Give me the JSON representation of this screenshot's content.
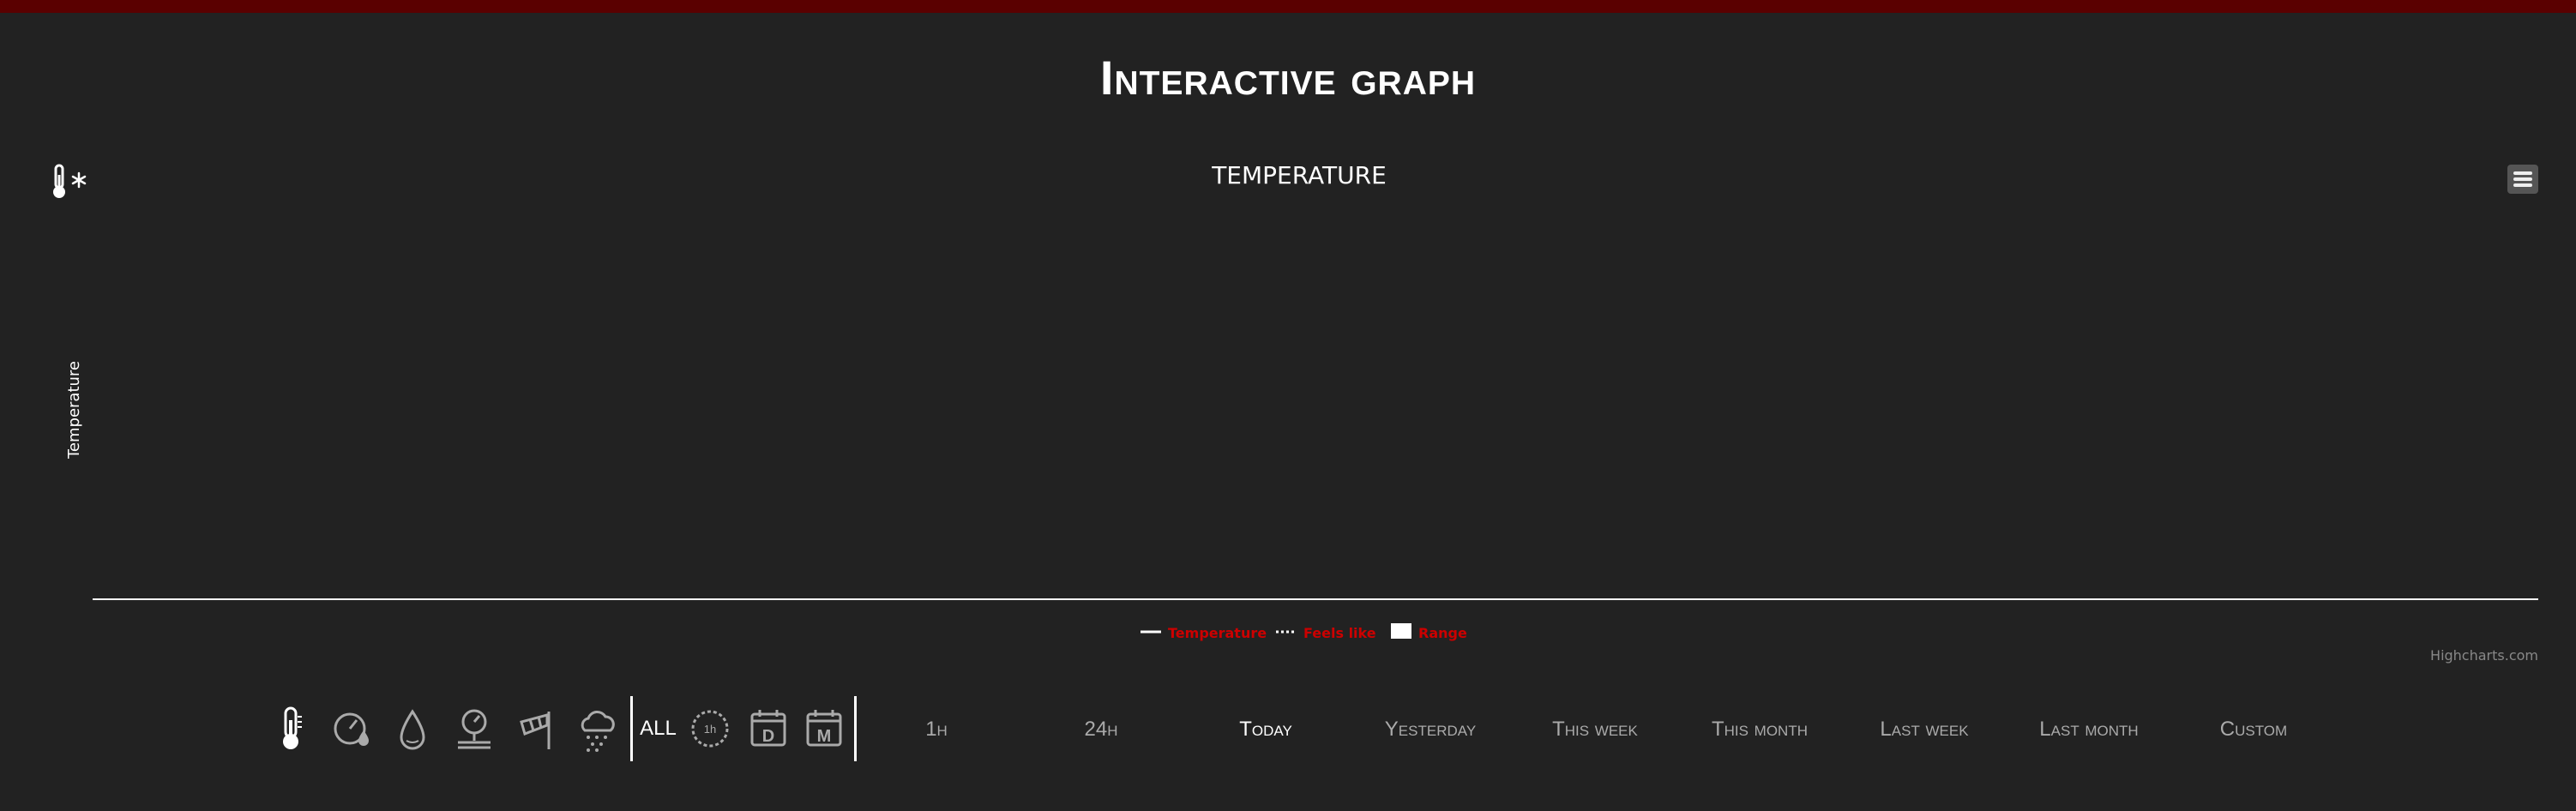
{
  "page": {
    "title": "Interactive graph"
  },
  "chart_data": {
    "type": "line",
    "title": "TEMPERATURE",
    "ylabel": "Temperature",
    "xlabel": "",
    "series": [
      {
        "name": "Temperature",
        "values": []
      },
      {
        "name": "Feels like",
        "values": []
      },
      {
        "name": "Range",
        "values": []
      }
    ],
    "legend": {
      "position": "bottom-center"
    },
    "credits": "Highcharts.com",
    "grid": false,
    "colors": {
      "axis": "#ffffff",
      "legend_text": "#cc0000",
      "credits": "#888888"
    }
  },
  "sensor_icons": [
    {
      "name": "thermometer-icon",
      "active": true
    },
    {
      "name": "pressure-gauge-icon",
      "active": false
    },
    {
      "name": "humidity-drop-icon",
      "active": false
    },
    {
      "name": "barometer-icon",
      "active": false
    },
    {
      "name": "windsock-icon",
      "active": false
    },
    {
      "name": "rain-cloud-icon",
      "active": false
    }
  ],
  "all_label": "ALL",
  "period_icons": [
    "hour-clock-icon",
    "day-calendar-icon",
    "month-calendar-icon"
  ],
  "period_icon_letters": {
    "hour": "1h",
    "day": "D",
    "month": "M"
  },
  "ranges": [
    {
      "label": "1h",
      "active": false
    },
    {
      "label": "24h",
      "active": false
    },
    {
      "label": "Today",
      "active": true
    },
    {
      "label": "Yesterday",
      "active": false
    },
    {
      "label": "This week",
      "active": false
    },
    {
      "label": "This month",
      "active": false
    },
    {
      "label": "Last week",
      "active": false
    },
    {
      "label": "Last month",
      "active": false
    },
    {
      "label": "Custom",
      "active": false
    }
  ]
}
